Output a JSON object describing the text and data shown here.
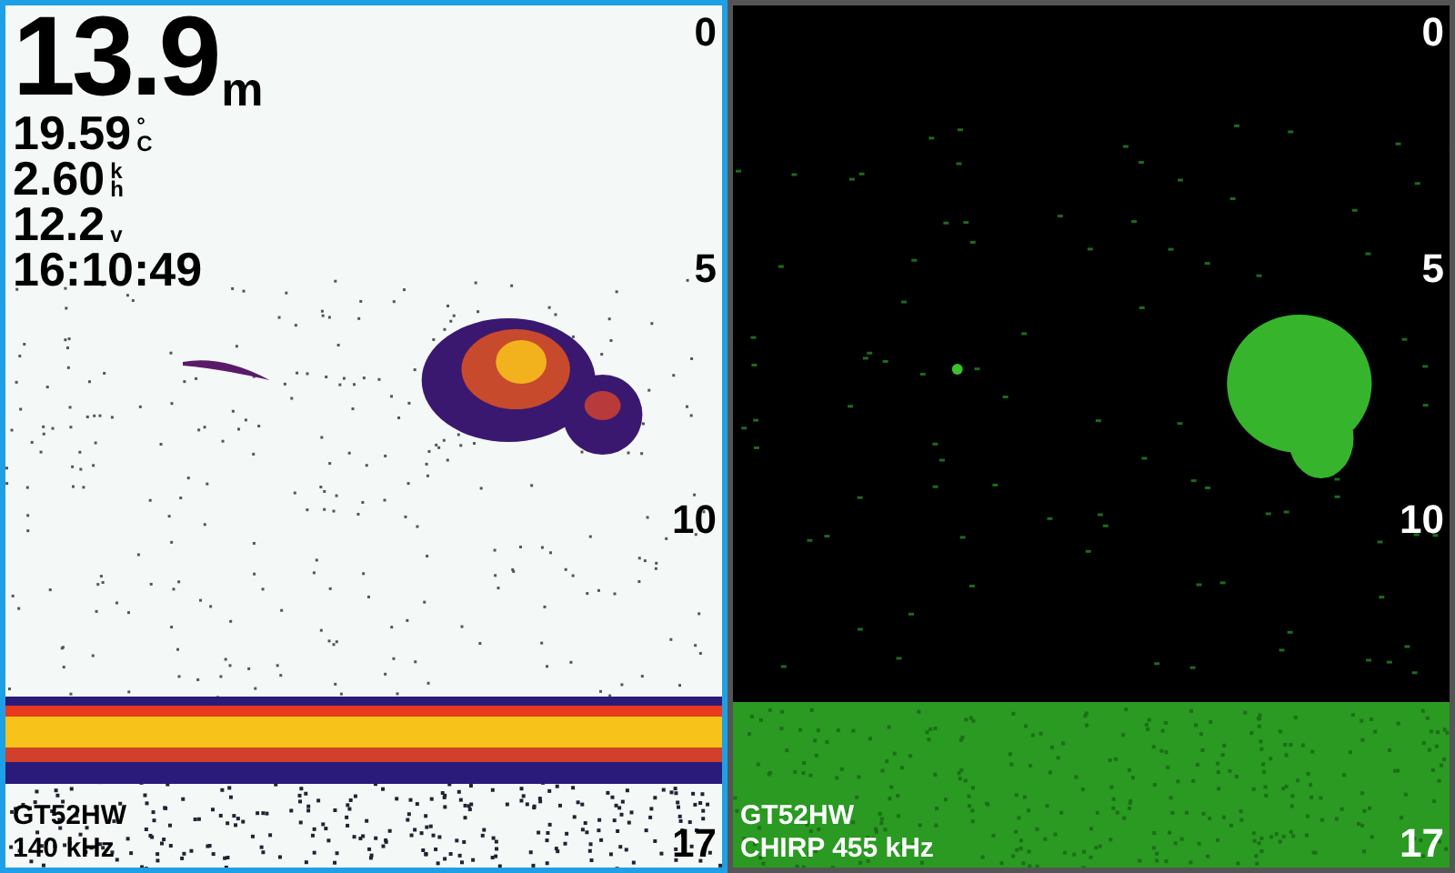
{
  "panes": [
    {
      "kind": "traditional",
      "selected": true,
      "readings": {
        "depth": {
          "value": "13.9",
          "unit": "m"
        },
        "lines": [
          {
            "value": "19.59",
            "unit_top": "°",
            "unit_bottom": "C"
          },
          {
            "value": "2.60",
            "unit_top": "k",
            "unit_bottom": "h"
          },
          {
            "value": "12.2",
            "unit_bottom": "v"
          },
          {
            "value": "16:10:49"
          }
        ]
      },
      "depth_scale": [
        "0",
        "5",
        "10"
      ],
      "bottom_depth": "17",
      "transducer": "GT52HW",
      "frequency": "140 kHz"
    },
    {
      "kind": "chirp",
      "selected": false,
      "depth_scale": [
        "0",
        "5",
        "10"
      ],
      "bottom_depth": "17",
      "transducer": "GT52HW",
      "frequency": "CHIRP 455 kHz"
    }
  ]
}
